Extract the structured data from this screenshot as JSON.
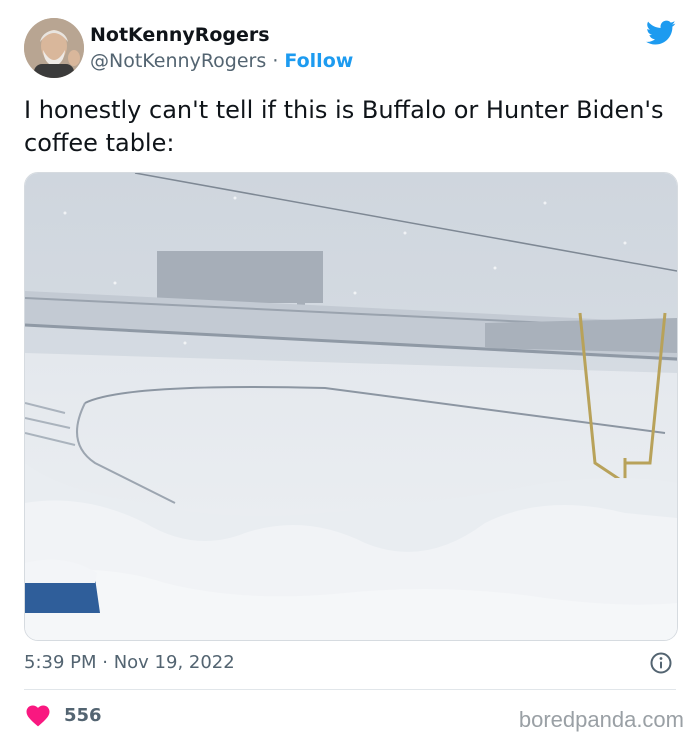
{
  "tweet": {
    "author": {
      "display_name": "NotKennyRogers",
      "handle": "@NotKennyRogers",
      "separator": "·",
      "follow_label": "Follow",
      "avatar_icon": "person-avatar"
    },
    "logo_icon": "twitter-bird-icon",
    "text": "I honestly can't tell if this is Buffalo or Hunter Biden's coffee table:",
    "media": {
      "description_icon": "snow-covered-stadium-photo"
    },
    "timestamp": "5:39 PM · Nov 19, 2022",
    "info_icon": "info-icon",
    "likes": {
      "icon": "heart-icon",
      "count": "556"
    }
  },
  "watermark": "boredpanda.com",
  "colors": {
    "accent": "#1d9bf0",
    "heart": "#f91880",
    "secondary_text": "#536471"
  }
}
